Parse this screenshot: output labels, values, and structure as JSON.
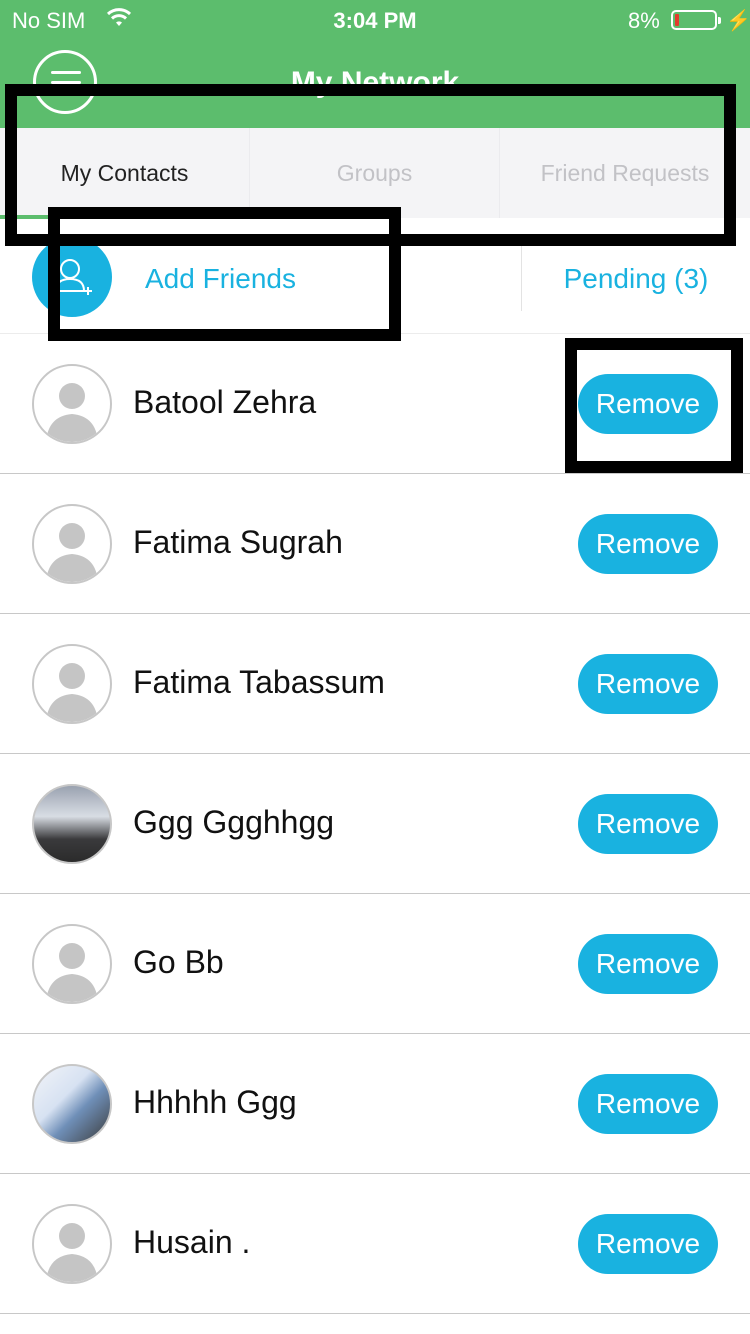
{
  "status_bar": {
    "carrier": "No SIM",
    "time": "3:04 PM",
    "battery_percent": "8%",
    "battery_level": 0.08
  },
  "header": {
    "title": "My Network",
    "menu_icon": "hamburger-menu-icon",
    "background_color": "#5cbd6d"
  },
  "tabs": [
    {
      "label": "My Contacts",
      "active": true
    },
    {
      "label": "Groups",
      "active": false
    },
    {
      "label": "Friend Requests",
      "active": false
    }
  ],
  "actions": {
    "add_friends_label": "Add Friends",
    "add_friends_icon": "add-user-icon",
    "pending_label": "Pending (3)"
  },
  "contacts": [
    {
      "name": "Batool Zehra",
      "remove_label": "Remove",
      "avatar": "default-avatar"
    },
    {
      "name": "Fatima Sugrah",
      "remove_label": "Remove",
      "avatar": "default-avatar"
    },
    {
      "name": "Fatima Tabassum",
      "remove_label": "Remove",
      "avatar": "default-avatar"
    },
    {
      "name": "Ggg Ggghhgg",
      "remove_label": "Remove",
      "avatar": "photo"
    },
    {
      "name": "Go Bb",
      "remove_label": "Remove",
      "avatar": "default-avatar"
    },
    {
      "name": "Hhhhh Ggg",
      "remove_label": "Remove",
      "avatar": "photo"
    },
    {
      "name": "Husain .",
      "remove_label": "Remove",
      "avatar": "default-avatar"
    }
  ],
  "colors": {
    "accent": "#19b2e0",
    "green": "#5cbd6d"
  }
}
